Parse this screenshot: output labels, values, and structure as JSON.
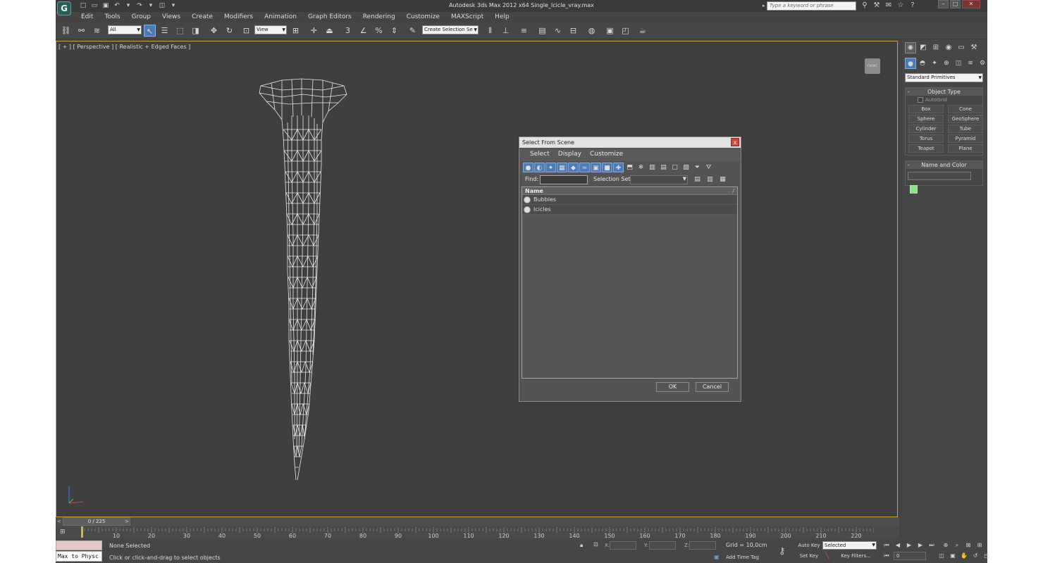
{
  "titlebar": {
    "title": "Autodesk 3ds Max  2012 x64      Single_Icicle_vray.max",
    "search_placeholder": "Type a keyword or phrase",
    "logo": "G"
  },
  "menu": [
    "Edit",
    "Tools",
    "Group",
    "Views",
    "Create",
    "Modifiers",
    "Animation",
    "Graph Editors",
    "Rendering",
    "Customize",
    "MAXScript",
    "Help"
  ],
  "toolbar": {
    "selection_filter": "All",
    "coord_system": "View",
    "named_selection": "Create Selection Se",
    "angle_snap_label": "3"
  },
  "viewport": {
    "label": "[ + ] [ Perspective ] [ Realistic + Edged Faces ]",
    "viewcube_label": "FRONT"
  },
  "dialog": {
    "title": "Select From Scene",
    "close": "x",
    "menu": [
      "Select",
      "Display",
      "Customize"
    ],
    "find_label": "Find:",
    "find_value": "",
    "selection_set_label": "Selection Set:",
    "selection_set_value": "",
    "list_header": "Name",
    "list_sort_indicator": "/",
    "items": [
      {
        "name": "Bubbles"
      },
      {
        "name": "Icicles"
      }
    ],
    "ok_label": "OK",
    "cancel_label": "Cancel"
  },
  "command_panel": {
    "dropdown": "Standard Primitives",
    "object_type_title": "Object Type",
    "autogrid_label": "AutoGrid",
    "autogrid_checked": false,
    "primitives": [
      "Box",
      "Cone",
      "Sphere",
      "GeoSphere",
      "Cylinder",
      "Tube",
      "Torus",
      "Pyramid",
      "Teapot",
      "Plane"
    ],
    "name_color_title": "Name and Color",
    "name_value": "",
    "swatch_color": "#8ee38a"
  },
  "timeline": {
    "frame_display": "0 / 225",
    "prev": "<",
    "next": ">",
    "ticks": [
      "10",
      "20",
      "30",
      "40",
      "50",
      "60",
      "70",
      "80",
      "90",
      "100",
      "110",
      "120",
      "130",
      "140",
      "150",
      "160",
      "170",
      "180",
      "190",
      "200",
      "210",
      "220"
    ]
  },
  "status": {
    "maxscript_text": "Max to Physc",
    "selection_status": "None Selected",
    "prompt": "Click or click-and-drag to select objects",
    "x_label": "X:",
    "y_label": "Y:",
    "z_label": "Z:",
    "grid": "Grid = 10,0cm",
    "add_time_tag": "Add Time Tag",
    "auto_key": "Auto Key",
    "set_key": "Set Key",
    "key_mode": "Selected",
    "key_filters": "Key Filters...",
    "current_frame": "0"
  }
}
